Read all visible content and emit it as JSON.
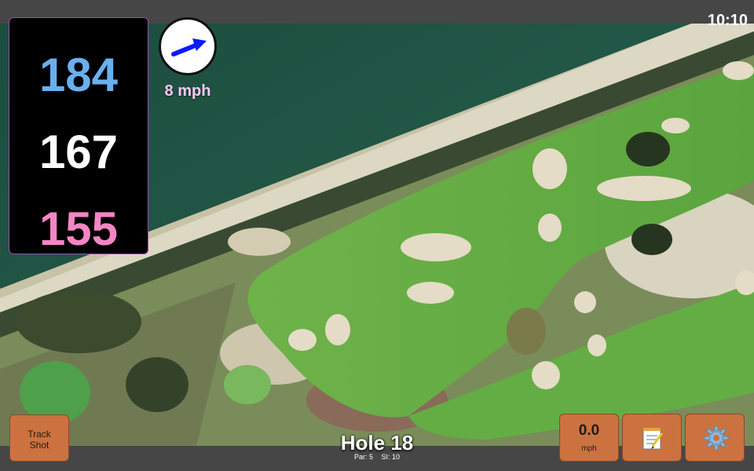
{
  "clock": "10:10",
  "distances": {
    "back": "184",
    "center": "167",
    "front": "155"
  },
  "wind": {
    "speed": "8 mph",
    "icon": "wind-direction-arrow-icon"
  },
  "hole": {
    "title": "Hole 18",
    "par": "Par: 5",
    "stroke_index": "SI: 10"
  },
  "buttons": {
    "track_shot_line1": "Track",
    "track_shot_line2": "Shot",
    "speed_value": "0.0",
    "speed_unit": "mph",
    "notes_icon": "notepad-icon",
    "settings_icon": "gear-icon"
  },
  "colors": {
    "back_distance": "#6ab0ee",
    "center_distance": "#ffffff",
    "front_distance": "#f386c4",
    "button": "#cc7240",
    "wind_text": "#ffc8f4"
  }
}
